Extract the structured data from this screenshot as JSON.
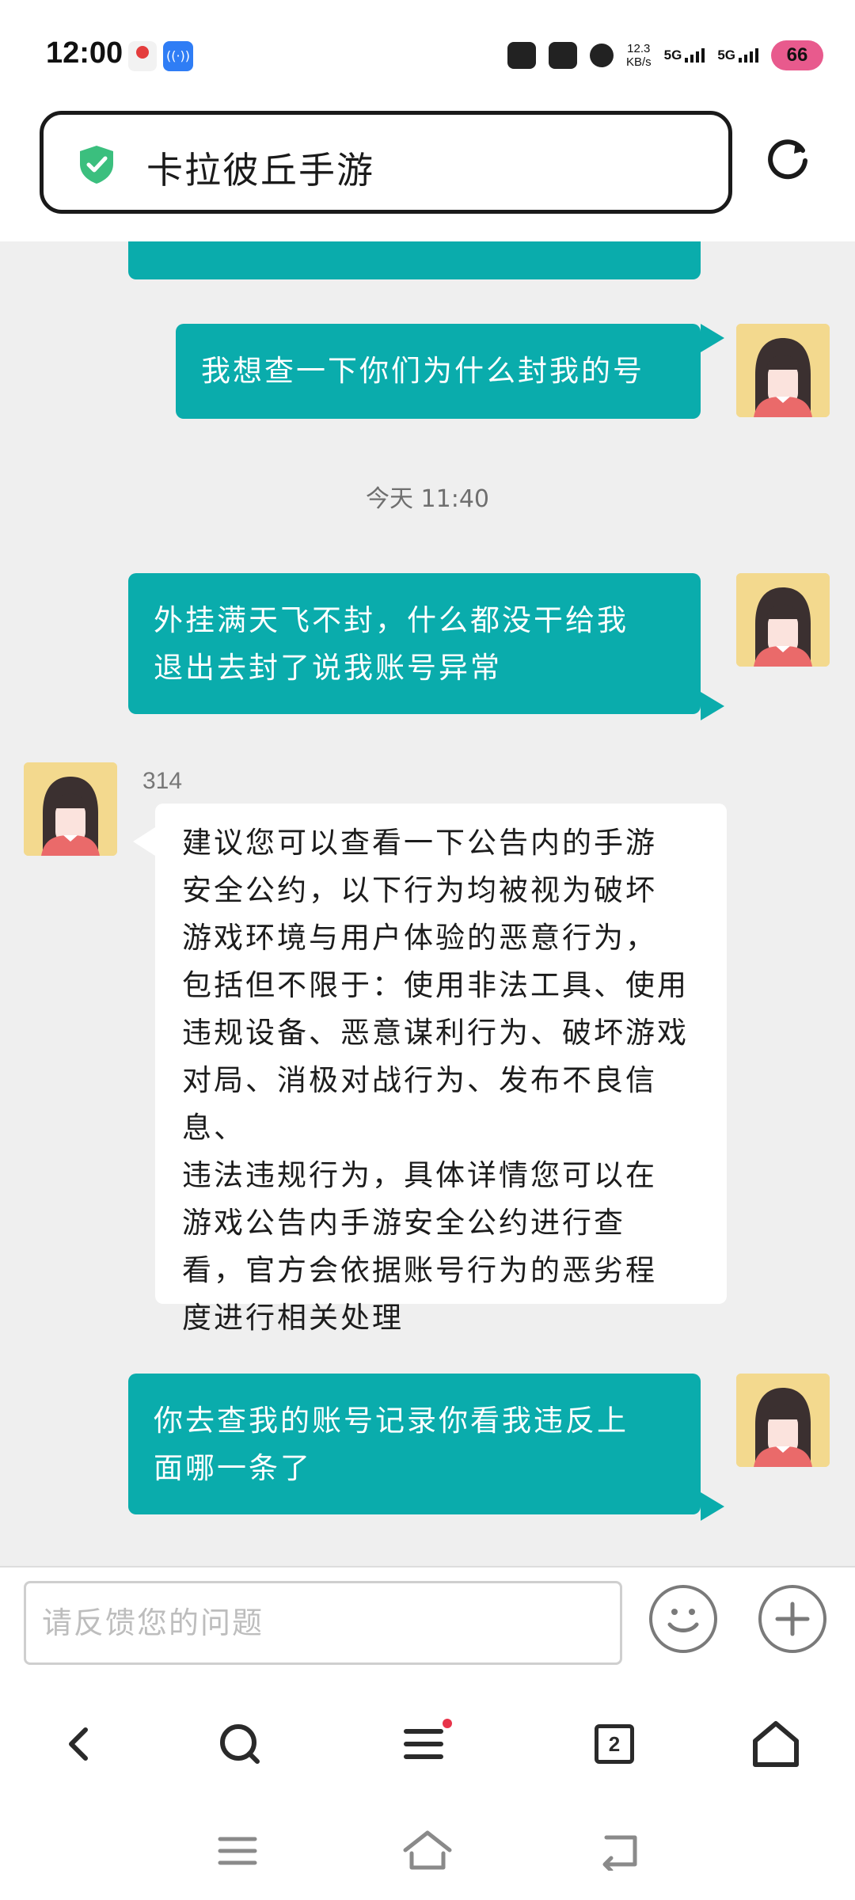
{
  "status_bar": {
    "time": "12:00",
    "net_speed_value": "12.3",
    "net_speed_unit": "KB/s",
    "network1": "5G",
    "network2": "5G",
    "battery": "66"
  },
  "address_bar": {
    "title": "卡拉彼丘手游"
  },
  "chat": {
    "timestamp": "今天 11:40",
    "agent_name": "314",
    "messages": [
      {
        "from": "user",
        "lines": [
          "我想查一下你们为什么封我的号"
        ]
      },
      {
        "from": "user",
        "lines": [
          "外挂满天飞不封，什么都没干给我",
          "退出去封了说我账号异常"
        ]
      },
      {
        "from": "agent",
        "lines": [
          "建议您可以查看一下公告内的手游",
          "安全公约，以下行为均被视为破坏",
          "游戏环境与用户体验的恶意行为，",
          "包括但不限于：使用非法工具、使用",
          "违规设备、恶意谋利行为、破坏游戏",
          "对局、消极对战行为、发布不良信息、",
          "违法违规行为，具体详情您可以在",
          "游戏公告内手游安全公约进行查",
          "看，官方会依据账号行为的恶劣程",
          "度进行相关处理"
        ]
      },
      {
        "from": "user",
        "lines": [
          "你去查我的账号记录你看我违反上",
          "面哪一条了"
        ]
      }
    ]
  },
  "input": {
    "placeholder": "请反馈您的问题"
  },
  "browser_nav": {
    "tab_count": "2"
  },
  "colors": {
    "accent_teal": "#0aacac",
    "chat_bg": "#efefef",
    "shield_green": "#3bbf7e",
    "notification_red": "#e8344a"
  }
}
